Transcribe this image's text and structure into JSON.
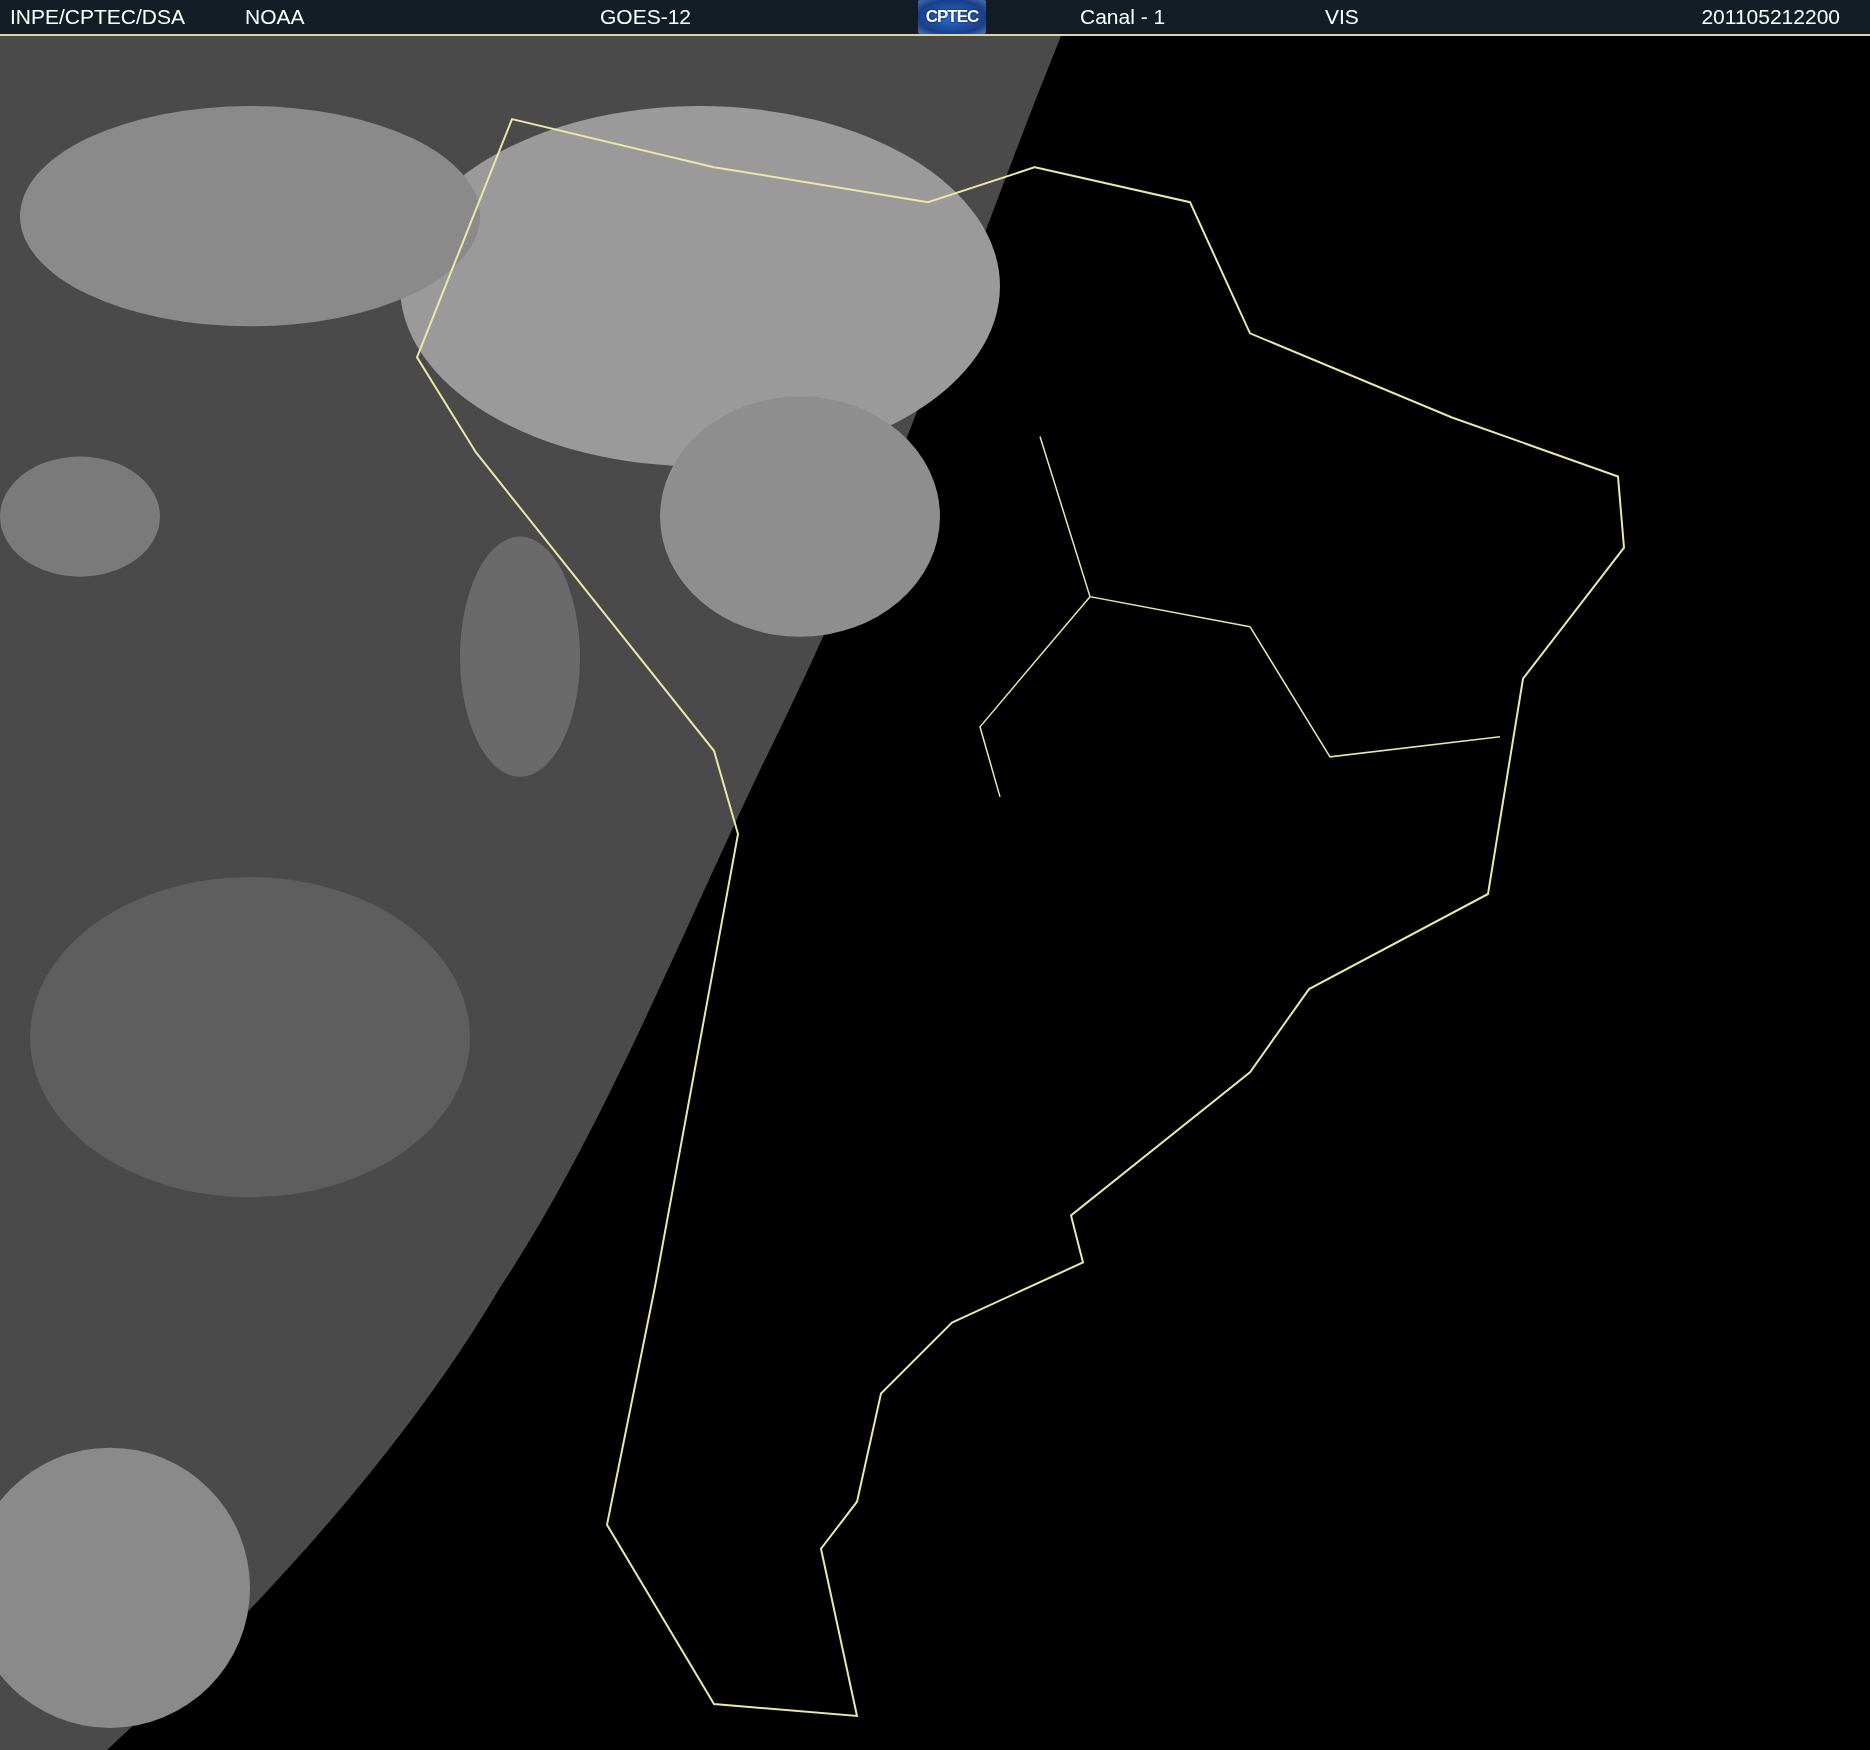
{
  "header": {
    "items": [
      {
        "kind": "text",
        "text": "INPE/CPTEC/DSA"
      },
      {
        "kind": "text",
        "text": "NOAA"
      },
      {
        "kind": "text",
        "text": "GOES-12"
      },
      {
        "kind": "logo",
        "text": "CPTEC"
      },
      {
        "kind": "text",
        "text": "Canal - 1"
      },
      {
        "kind": "text",
        "text": "VIS"
      },
      {
        "kind": "text",
        "text": "201105212200"
      }
    ]
  }
}
